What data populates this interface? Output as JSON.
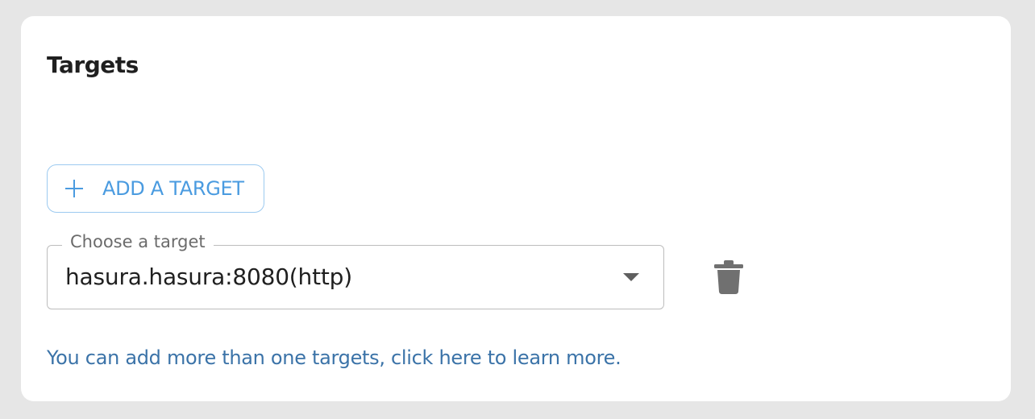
{
  "card": {
    "title": "Targets"
  },
  "add_button": {
    "label": "ADD A TARGET",
    "icon": "plus-icon"
  },
  "target_select": {
    "legend": "Choose a target",
    "value": "hasura.hasura:8080(http)",
    "icon": "chevron-down-icon"
  },
  "delete_button": {
    "icon": "trash-icon"
  },
  "help": {
    "link_text": "You can add more than one targets, click here to learn more."
  },
  "colors": {
    "accent": "#4a9be0",
    "link": "#3b73a8",
    "background": "#e6e6e6"
  }
}
